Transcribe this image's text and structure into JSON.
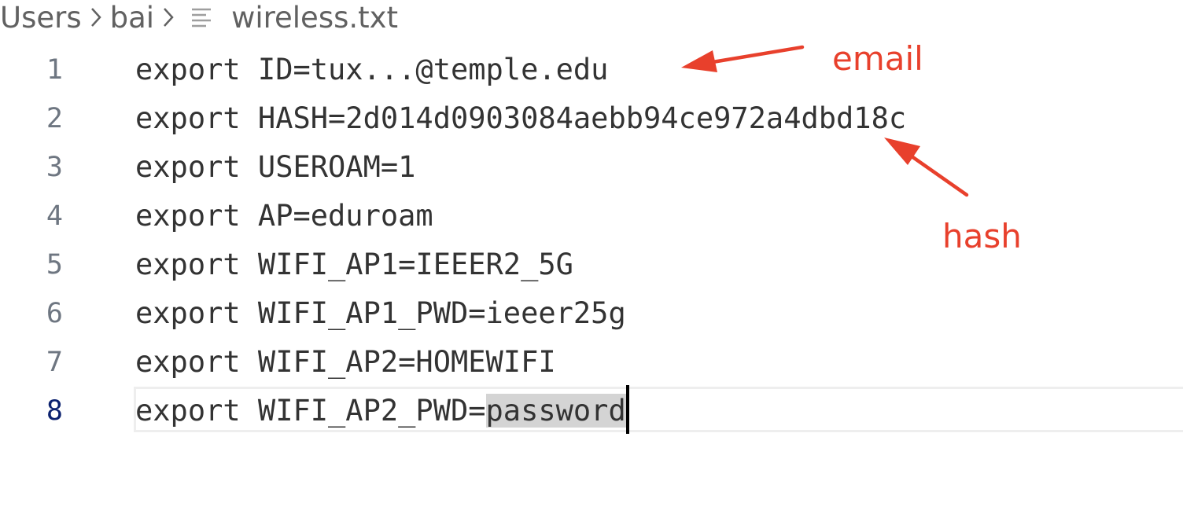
{
  "breadcrumb": {
    "items": [
      "Users",
      "bai"
    ],
    "file_name": "wireless.txt",
    "separator_icon": "chevron-right-icon",
    "file_icon": "text-file-icon"
  },
  "editor": {
    "current_line": 8,
    "lines": [
      {
        "number": "1",
        "text": "export ID=tux...@temple.edu"
      },
      {
        "number": "2",
        "text": "export HASH=2d014d0903084aebb94ce972a4dbd18c"
      },
      {
        "number": "3",
        "text": "export USEROAM=1"
      },
      {
        "number": "4",
        "text": "export AP=eduroam"
      },
      {
        "number": "5",
        "text": "export WIFI_AP1=IEEER2_5G"
      },
      {
        "number": "6",
        "text": "export WIFI_AP1_PWD=ieeer25g"
      },
      {
        "number": "7",
        "text": "export WIFI_AP2=HOMEWIFI"
      },
      {
        "number": "8",
        "text_before_selection": "export WIFI_AP2_PWD=",
        "selected_text": "password"
      }
    ]
  },
  "annotations": {
    "email_label": "email",
    "hash_label": "hash",
    "color": "#e8402c"
  },
  "colors": {
    "line_number": "#6e7681",
    "current_line_number": "#0b216f",
    "text": "#333333",
    "selection": "#d4d4d4",
    "current_line_border": "#eeeeee"
  }
}
